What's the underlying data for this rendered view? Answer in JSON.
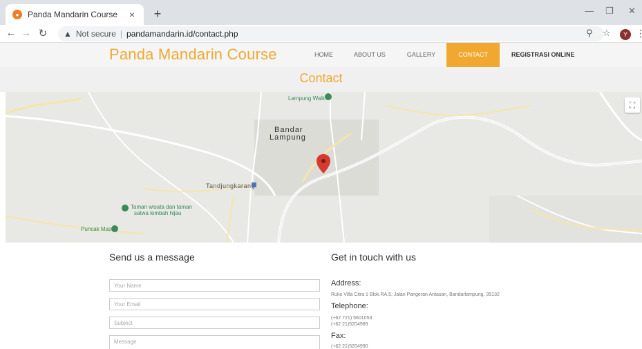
{
  "browser": {
    "tab_title": "Panda Mandarin Course",
    "tab_close": "×",
    "new_tab": "+",
    "not_secure": "Not secure",
    "url": "pandamandarin.id/contact.php",
    "avatar_letter": "Y"
  },
  "site": {
    "brand": "Panda Mandarin Course",
    "menu": [
      {
        "label": "HOME"
      },
      {
        "label": "ABOUT US"
      },
      {
        "label": "GALLERY"
      },
      {
        "label": "CONTACT"
      },
      {
        "label": "REGISTRASI ONLINE"
      }
    ],
    "page_title": "Contact"
  },
  "map": {
    "labels": {
      "lampung_walk": "Lampung Walk",
      "bandar": "Bandar",
      "lampung": "Lampung",
      "tandjungkarang": "Tandjungkarang",
      "taman_line1": "Taman wisata dan taman",
      "taman_line2": "satwa lembah hijau",
      "puncak_mas": "Puncak Mas"
    },
    "accent_color": "#f0a830",
    "marker_color": "#d63a2f"
  },
  "form": {
    "heading": "Send us a message",
    "name_placeholder": "Your Name",
    "email_placeholder": "Your Email",
    "subject_placeholder": "Subject",
    "message_placeholder": "Message"
  },
  "contact": {
    "heading": "Get in touch with us",
    "address_label": "Address:",
    "address_value": "Ruko Villa Citra 1 Blok.RA.5, Jalan Pangeran Antasari, Bandarlampung, 35132",
    "telephone_label": "Telephone:",
    "telephone_1": "(+62 721) 5601053",
    "telephone_2": "(+62 21)5204989",
    "fax_label": "Fax:",
    "fax_value": "(+62 21)5204990"
  }
}
